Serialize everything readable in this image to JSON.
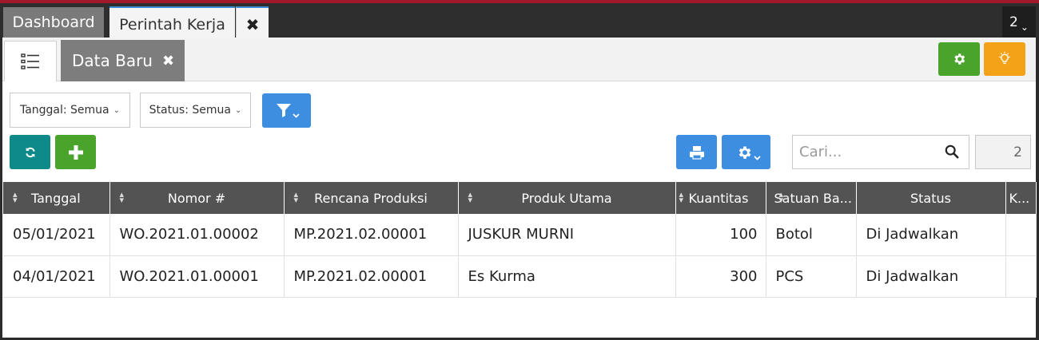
{
  "tabs": {
    "dashboard": "Dashboard",
    "work_order": "Perintah Kerja",
    "close": "✖",
    "count": "2",
    "count_chevron": "⌄"
  },
  "subtabs": {
    "data_baru": "Data Baru",
    "close": "✖"
  },
  "filters": {
    "date": "Tanggal: Semua",
    "status": "Status: Semua",
    "caret": "⌄"
  },
  "search": {
    "placeholder": "Cari...",
    "value": ""
  },
  "page_number": "2",
  "table": {
    "columns": [
      "Tanggal",
      "Nomor #",
      "Rencana Produksi",
      "Produk Utama",
      "Kuantitas",
      "Satuan Ba...",
      "Status",
      "K..."
    ],
    "rows": [
      [
        "05/01/2021",
        "WO.2021.01.00002",
        "MP.2021.02.00001",
        "JUSKUR MURNI",
        "100",
        "Botol",
        "Di Jadwalkan",
        ""
      ],
      [
        "04/01/2021",
        "WO.2021.01.00001",
        "MP.2021.02.00001",
        "Es Kurma",
        "300",
        "PCS",
        "Di Jadwalkan",
        ""
      ]
    ]
  },
  "colors": {
    "accent_green": "#4aa42b",
    "accent_orange": "#f4a217",
    "accent_teal": "#0e8a8a",
    "accent_blue": "#3d8ee0",
    "header_bg": "#535353",
    "top_border": "#a3172c"
  }
}
